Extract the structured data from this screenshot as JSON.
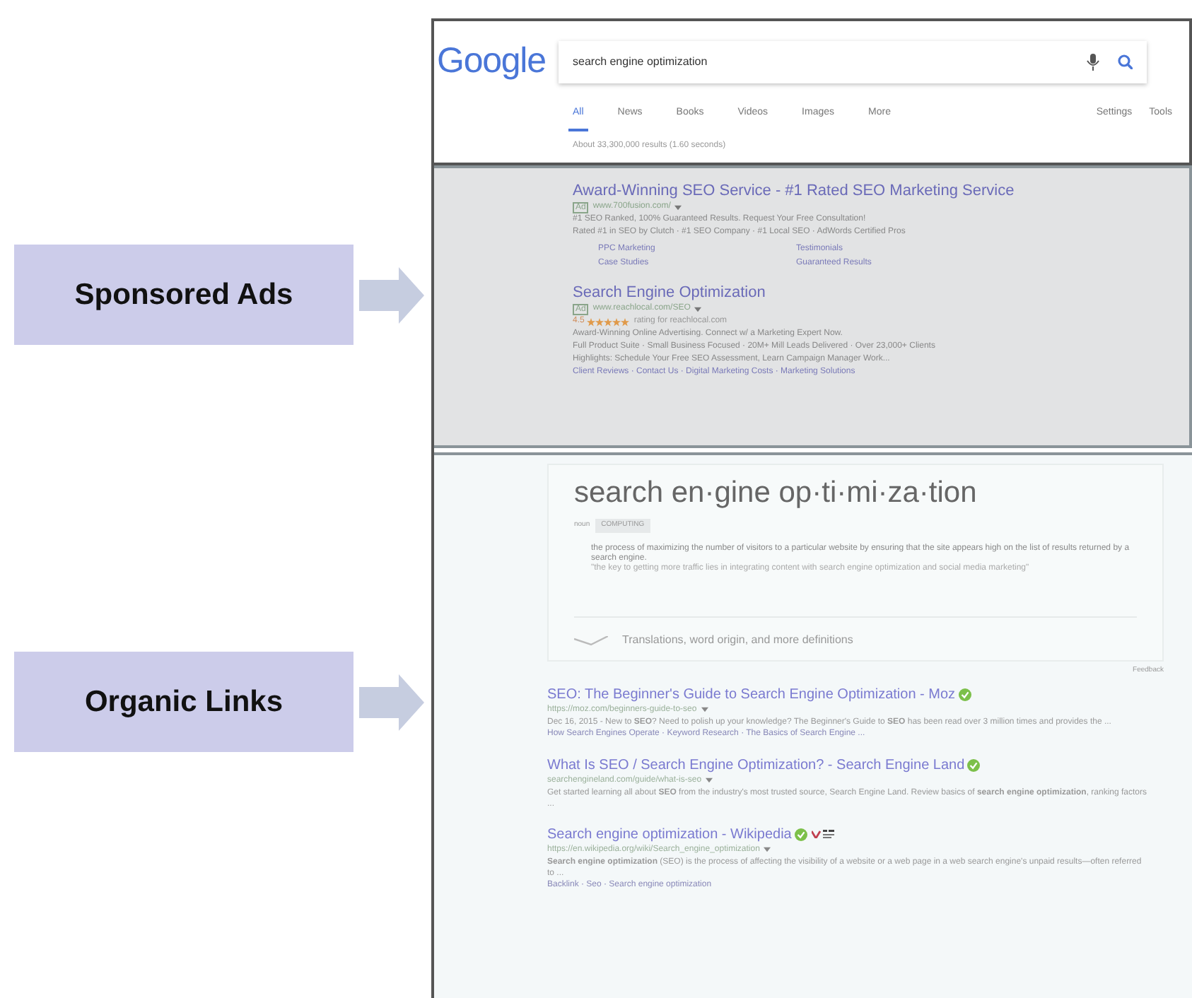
{
  "callouts": [
    {
      "label": "Sponsored Ads"
    },
    {
      "label": "Organic Links"
    }
  ],
  "search": {
    "logo": "Google",
    "query": "search engine optimization"
  },
  "tabs": [
    {
      "label": "All",
      "selected": true
    },
    {
      "label": "News",
      "selected": false
    },
    {
      "label": "Books",
      "selected": false
    },
    {
      "label": "Videos",
      "selected": false
    },
    {
      "label": "Images",
      "selected": false
    },
    {
      "label": "More",
      "selected": false
    }
  ],
  "tools": [
    "Settings",
    "Tools"
  ],
  "result_stats": "About 33,300,000 results (1.60 seconds)",
  "ads": [
    {
      "title": "Award-Winning SEO Service - #1 Rated SEO Marketing Service",
      "badge": "Ad",
      "url": "www.700fusion.com/",
      "lines": [
        "#1 SEO Ranked, 100% Guaranteed Results. Request Your Free Consultation!",
        "Rated #1 in SEO by Clutch · #1 SEO Company · #1 Local SEO · AdWords Certified Pros"
      ],
      "sitelinks": [
        "PPC Marketing",
        "Testimonials",
        "Case Studies",
        "Guaranteed Results"
      ]
    },
    {
      "title": "Search Engine Optimization",
      "badge": "Ad",
      "url": "www.reachlocal.com/SEO",
      "rating": {
        "score": "4.5",
        "stars": 5,
        "text": "rating for reachlocal.com"
      },
      "lines": [
        "Award-Winning Online Advertising. Connect w/ a Marketing Expert Now.",
        "Full Product Suite · Small Business Focused · 20M+ Mill Leads Delivered · Over 23,000+ Clients",
        "Highlights: Schedule Your Free SEO Assessment, Learn Campaign Manager Work..."
      ],
      "links": "Client Reviews · Contact Us · Digital Marketing Costs · Marketing Solutions"
    }
  ],
  "dictionary": {
    "word": "search en·gine op·ti·mi·za·tion",
    "part": "noun",
    "domain": "COMPUTING",
    "definition": "the process of maximizing the number of visitors to a particular website by ensuring that the site appears high on the list of results returned by a search engine.",
    "example": "\"the key to getting more traffic lies in integrating content with search engine optimization and social media marketing\"",
    "more": "Translations, word origin, and more definitions",
    "feedback": "Feedback"
  },
  "results": [
    {
      "title": "SEO: The Beginner's Guide to Search Engine Optimization - Moz",
      "verified": true,
      "extra_badge": false,
      "url": "https://moz.com/beginners-guide-to-seo",
      "snippet": "Dec 16, 2015 - New to **SEO**? Need to polish up your knowledge? The Beginner's Guide to **SEO** has been read over 3 million times and provides the ...",
      "links": "How Search Engines Operate · Keyword Research · The Basics of Search Engine ..."
    },
    {
      "title": "What Is SEO / Search Engine Optimization? - Search Engine Land",
      "verified": true,
      "extra_badge": false,
      "url": "searchengineland.com/guide/what-is-seo",
      "snippet": "Get started learning all about **SEO** from the industry's most trusted source, Search Engine Land. Review basics of **search engine optimization**, ranking factors ..."
    },
    {
      "title": "Search engine optimization - Wikipedia",
      "verified": true,
      "extra_badge": true,
      "url": "https://en.wikipedia.org/wiki/Search_engine_optimization",
      "snippet": "**Search engine optimization** (SEO) is the process of affecting the visibility of a website or a web page in a web search engine's unpaid results—often referred to ...",
      "links": "Backlink · Seo · Search engine optimization"
    }
  ]
}
